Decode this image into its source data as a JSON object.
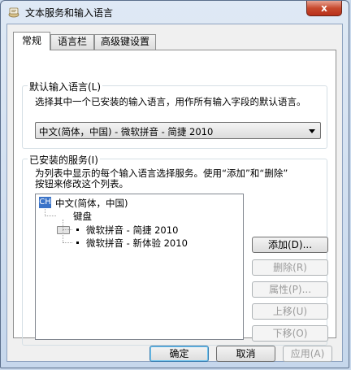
{
  "window": {
    "title": "文本服务和输入语言",
    "close_label": "x"
  },
  "tabs": [
    {
      "label": "常规",
      "active": true
    },
    {
      "label": "语言栏",
      "active": false
    },
    {
      "label": "高级键设置",
      "active": false
    }
  ],
  "default_language": {
    "group_label": "默认输入语言(L)",
    "description": "选择其中一个已安装的输入语言，用作所有输入字段的默认语言。",
    "selected": "中文(简体，中国) - 微软拼音 - 简捷 2010"
  },
  "installed_services": {
    "group_label": "已安装的服务(I)",
    "description_line1": "为列表中显示的每个输入语言选择服务。使用“添加”和“删除”",
    "description_line2": "按钮来修改这个列表。",
    "tree": {
      "language_badge": "CH",
      "language": "中文(简体，中国)",
      "category": "键盘",
      "services": [
        "微软拼音 - 简捷 2010",
        "微软拼音 - 新体验 2010"
      ]
    },
    "buttons": {
      "add": "添加(D)...",
      "remove": "删除(R)",
      "properties": "属性(P)...",
      "move_up": "上移(U)",
      "move_down": "下移(O)"
    }
  },
  "footer": {
    "ok": "确定",
    "cancel": "取消",
    "apply": "应用(A)"
  }
}
